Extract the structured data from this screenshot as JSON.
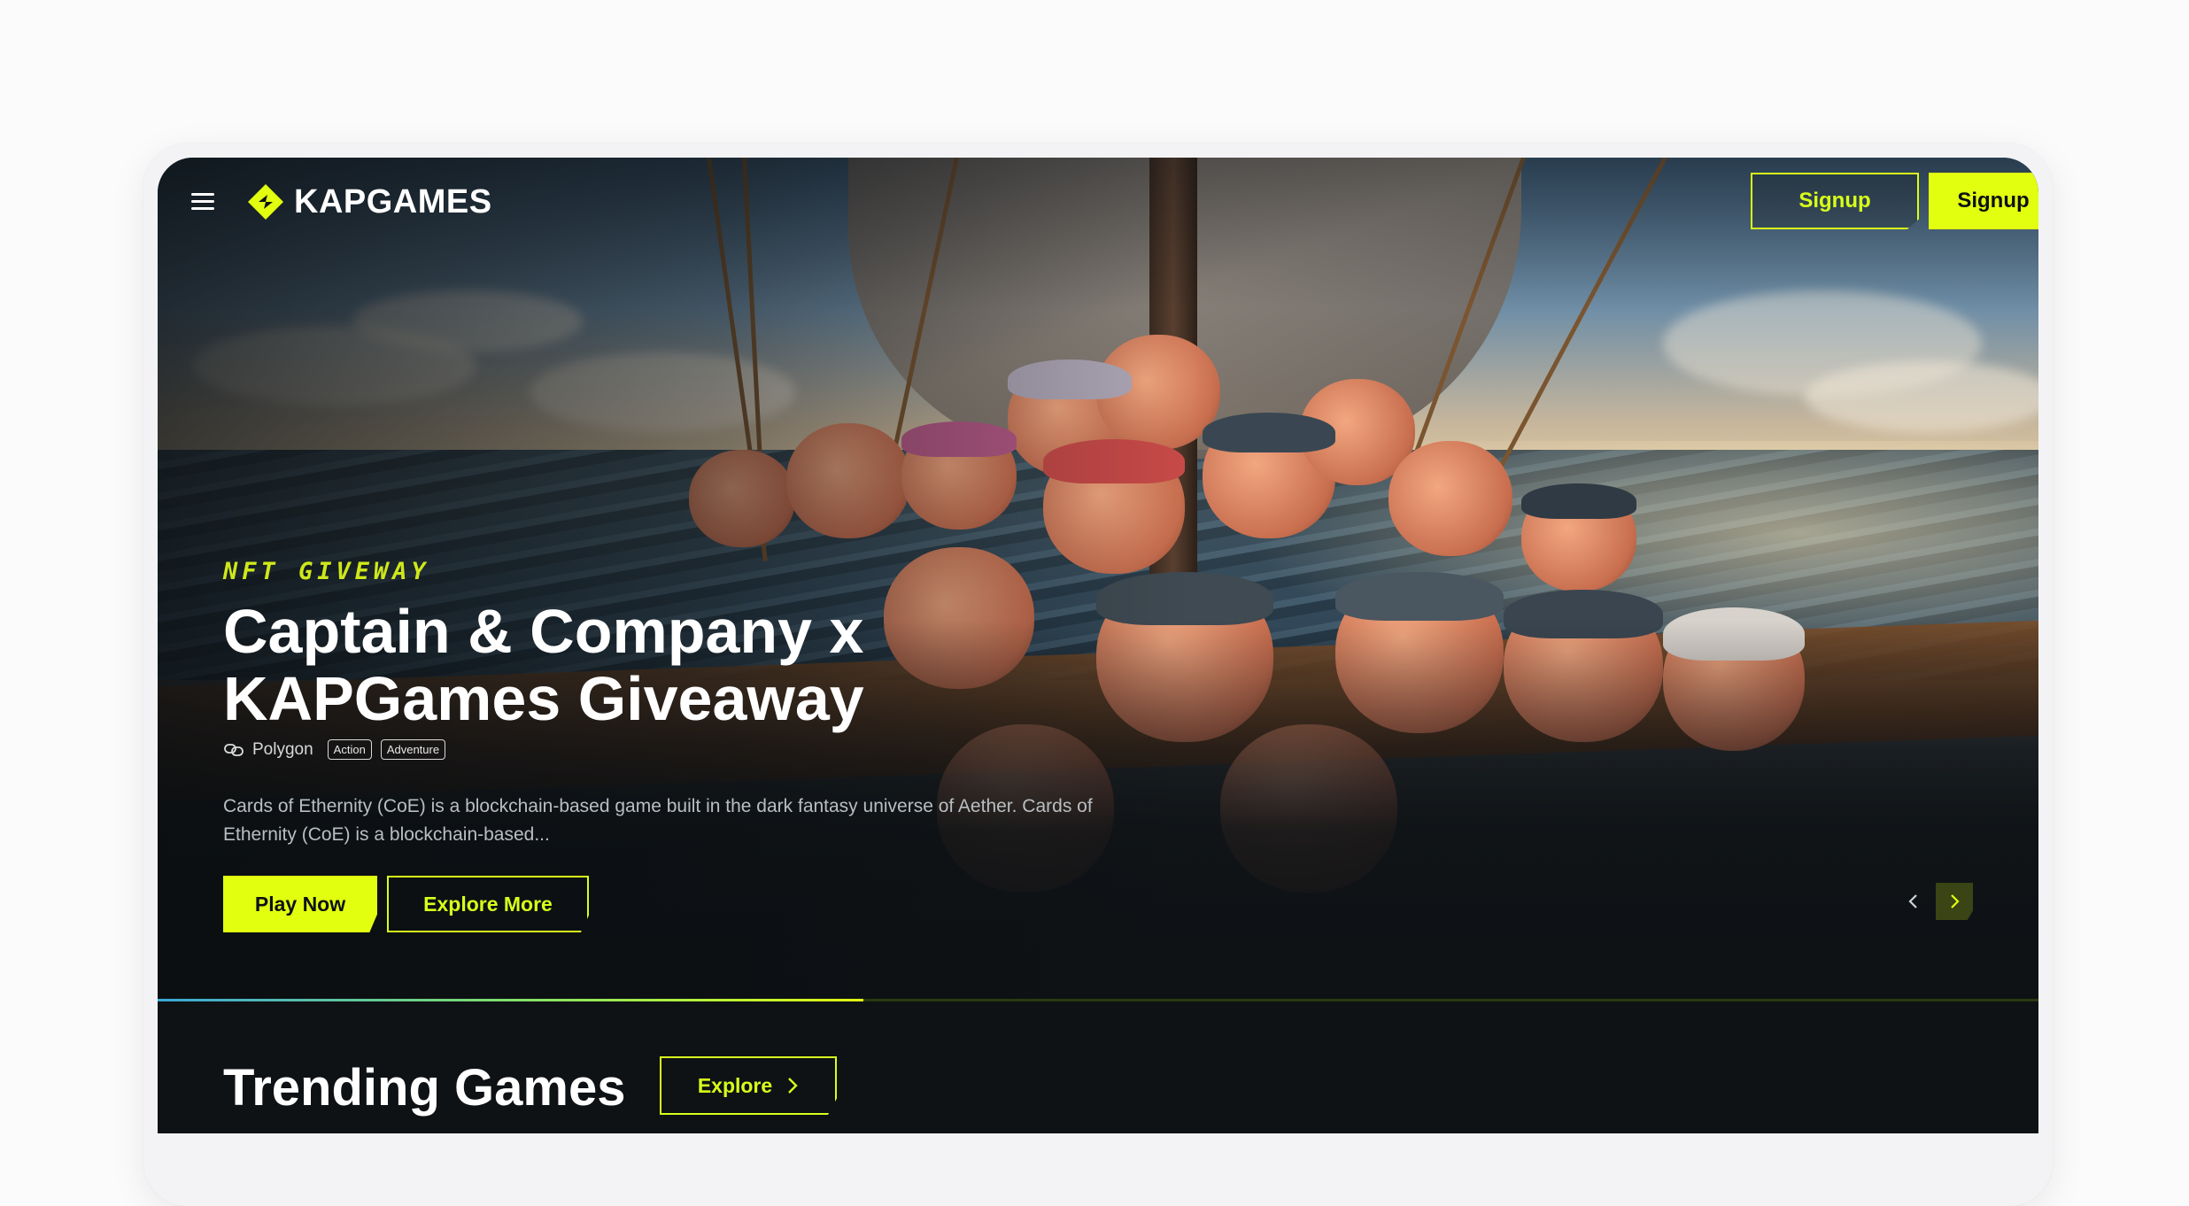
{
  "brand": {
    "name": "KAPGAMES",
    "accent": "#e2ff10"
  },
  "nav": {
    "menu_icon": "hamburger-icon",
    "signup_outline_label": "Signup",
    "signup_solid_label": "Signup"
  },
  "hero": {
    "eyebrow": "NFT GIVEWAY",
    "title": "Captain & Company x KAPGames Giveaway",
    "chain_icon": "chain-link-icon",
    "chain_label": "Polygon",
    "tags": [
      "Action",
      "Adventure"
    ],
    "description": "Cards of Ethernity (CoE) is a blockchain-based game built in the dark fantasy universe of Aether. Cards of Ethernity (CoE) is a blockchain-based...",
    "play_label": "Play Now",
    "explore_label": "Explore More",
    "prev_icon": "chevron-left-icon",
    "next_icon": "chevron-right-icon",
    "carousel_progress": 0.375
  },
  "trending": {
    "title": "Trending Games",
    "explore_label": "Explore",
    "explore_icon": "chevron-right-icon"
  }
}
